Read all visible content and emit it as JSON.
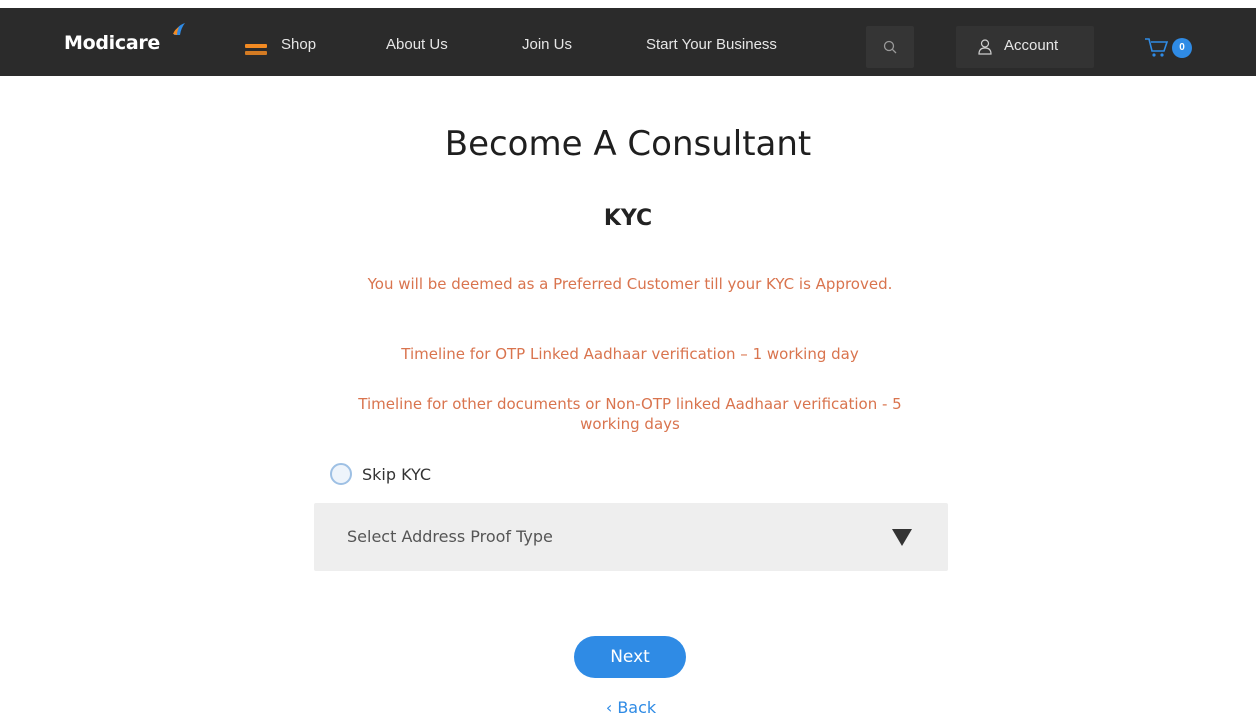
{
  "colors": {
    "nav_bg": "#2b2b2b",
    "accent_orange": "#f28a22",
    "accent_blue": "#2f8be5",
    "notice_text": "#d9744e"
  },
  "nav": {
    "logo": "Modicare",
    "items": [
      {
        "label": "Shop",
        "icon": "hamburger-icon"
      },
      {
        "label": "About Us"
      },
      {
        "label": "Join Us"
      },
      {
        "label": "Start Your Business"
      }
    ],
    "search_icon": "search-icon",
    "account_label": "Account",
    "account_icon": "user-icon",
    "cart_icon": "cart-icon",
    "cart_count": "0"
  },
  "main": {
    "title": "Become A Consultant",
    "section_title": "KYC",
    "notices": [
      "You will be deemed as a Preferred Customer till your KYC is Approved.",
      "Timeline for OTP Linked Aadhaar verification – 1 working day",
      "Timeline for other documents or Non-OTP linked Aadhaar verification - 5 working days"
    ],
    "skip_kyc_label": "Skip KYC",
    "skip_kyc_checked": false,
    "address_proof_select": {
      "value": "Select Address Proof Type"
    },
    "next_label": "Next",
    "back_label": "‹ Back"
  }
}
